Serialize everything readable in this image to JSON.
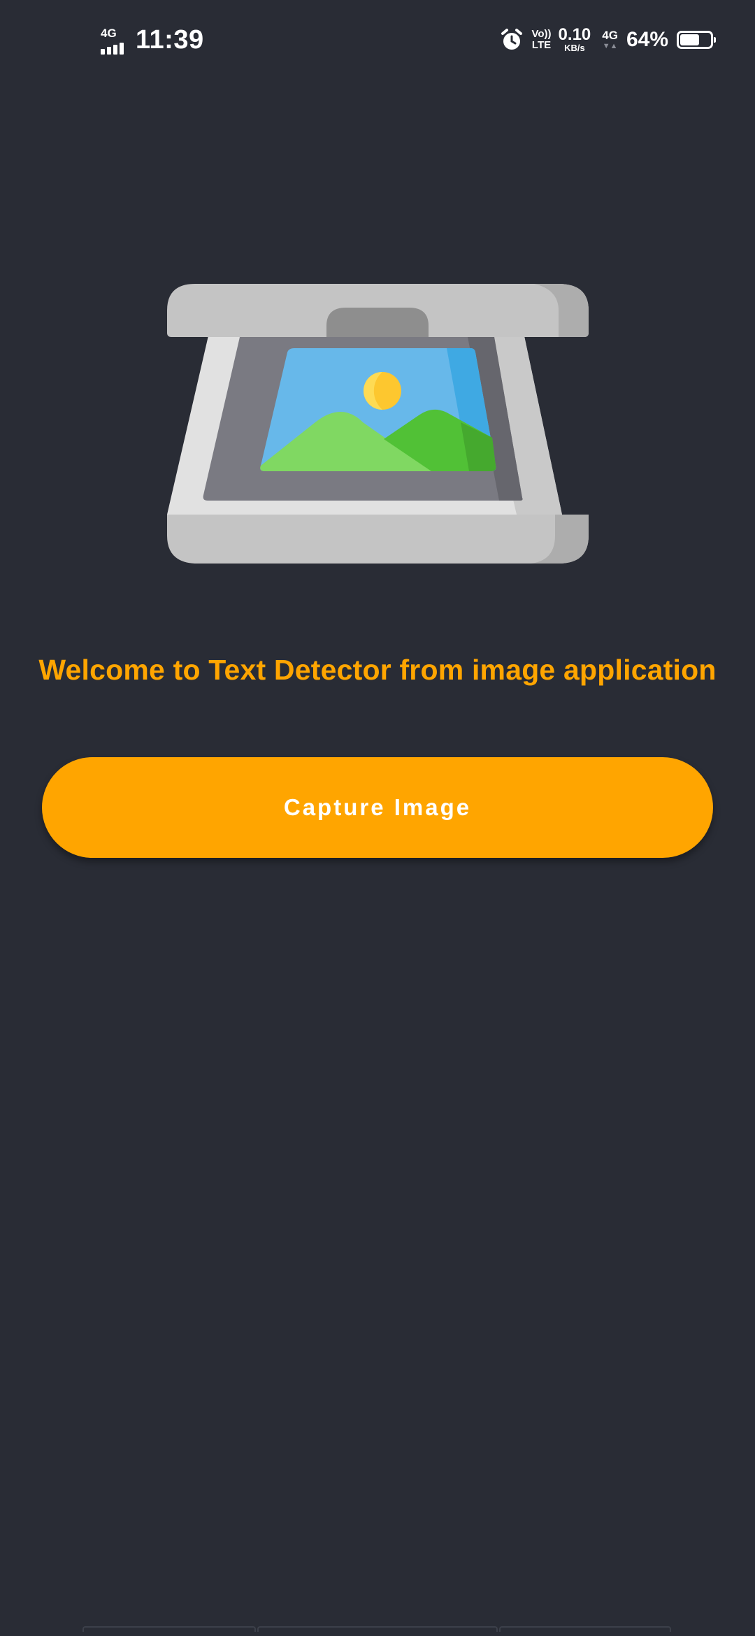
{
  "status_bar": {
    "network_left": "4G",
    "time": "11:39",
    "volte_top": "Vo))",
    "volte_bottom": "LTE",
    "speed_value": "0.10",
    "speed_unit": "KB/s",
    "network_right": "4G",
    "battery_percent": "64%",
    "battery_level": 0.64,
    "icons": [
      "signal-icon",
      "alarm-icon",
      "battery-icon"
    ]
  },
  "illustration": {
    "icon": "scanner-icon",
    "colors": {
      "lid": "#c4c4c4",
      "body": "#e0e0e0",
      "bed": "#7a7a82",
      "sky": "#67b8ea",
      "sun": "#fdc72f",
      "hill": "#80d862"
    }
  },
  "main": {
    "welcome_text": "Welcome to Text Detector from image application",
    "capture_label": "Capture Image"
  },
  "theme": {
    "background": "#292c35",
    "accent": "#ffa500"
  }
}
